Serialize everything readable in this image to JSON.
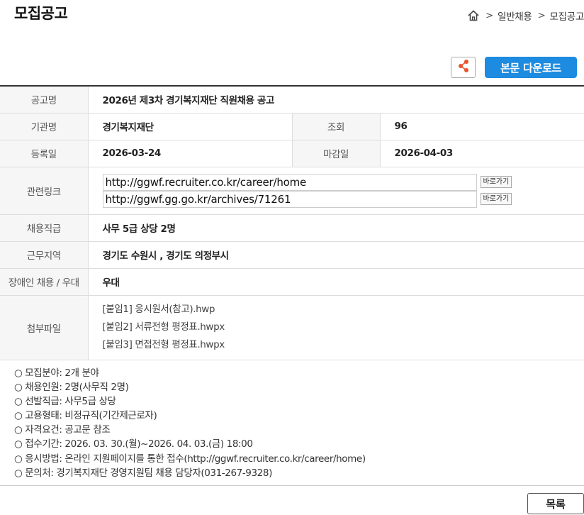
{
  "header": {
    "title": "모집공고",
    "breadcrumb": [
      "일반채용",
      "모집공고"
    ],
    "breadcrumb_sep": ">"
  },
  "actions": {
    "share_icon": "share-icon",
    "download_label": "본문 다운로드",
    "accent_color": "#1d8be0"
  },
  "info": {
    "title_label": "공고명",
    "title_value": "2026년 제3차 경기복지재단 직원채용 공고",
    "org_label": "기관명",
    "org_value": "경기복지재단",
    "views_label": "조회",
    "views_value": "96",
    "reg_label": "등록일",
    "reg_value": "2026-03-24",
    "deadline_label": "마감일",
    "deadline_value": "2026-04-03",
    "links_label": "관련링크",
    "links": [
      {
        "url": "http://ggwf.recruiter.co.kr/career/home",
        "button": "바로가기"
      },
      {
        "url": "http://ggwf.gg.go.kr/archives/71261",
        "button": "바로가기"
      }
    ],
    "position_label": "채용직급",
    "position_value": "사무 5급 상당 2명",
    "region_label": "근무지역",
    "region_value": "경기도 수원시 ,  경기도 의정부시",
    "disability_label": "장애인 채용 / 우대",
    "disability_value": "우대",
    "files_label": "첨부파일",
    "files": [
      "[붙임1] 응시원서(참고).hwp",
      "[붙임2] 서류전형 평정표.hwpx",
      "[붙임3] 면접전형 평정표.hwpx"
    ]
  },
  "summary": [
    "○ 모집분야: 2개 분야",
    "○ 채용인원: 2명(사무직 2명)",
    "○ 선발직급: 사무5급 상당",
    "○ 고용형태: 비정규직(기간제근로자)",
    "○ 자격요건: 공고문 참조",
    "○ 접수기간: 2026. 03. 30.(월)~2026. 04. 03.(금) 18:00",
    "○ 응시방법: 온라인 지원페이지를 통한 접수(http://ggwf.recruiter.co.kr/career/home)",
    "○ 문의처: 경기복지재단 경영지원팀 채용 담당자(031-267-9328)"
  ],
  "footer": {
    "list_label": "목록"
  }
}
